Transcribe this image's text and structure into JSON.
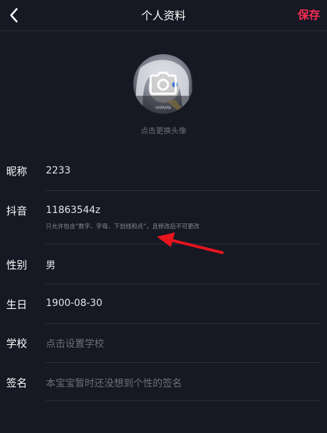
{
  "header": {
    "title": "个人资料",
    "save_label": "保存"
  },
  "avatar": {
    "hint": "点击更换头像",
    "image_text": "miHoYo"
  },
  "fields": {
    "nickname": {
      "label": "昵称",
      "value": "2233"
    },
    "douyin_id": {
      "label": "抖音",
      "value": "11863544z",
      "note": "只允许包含“数字、字母、下划线和点”，且修改后不可更改"
    },
    "gender": {
      "label": "性别",
      "value": "男"
    },
    "birthday": {
      "label": "生日",
      "value": "1900-08-30"
    },
    "school": {
      "label": "学校",
      "placeholder": "点击设置学校"
    },
    "signature": {
      "label": "签名",
      "placeholder": "本宝宝暂时还没想到个性的签名"
    }
  },
  "colors": {
    "background": "#161823",
    "accent": "#fe2c55",
    "annotation_arrow": "#e8141e"
  },
  "icons": {
    "back": "chevron-left-icon",
    "camera": "camera-icon",
    "annotation": "arrow-annotation-icon"
  }
}
